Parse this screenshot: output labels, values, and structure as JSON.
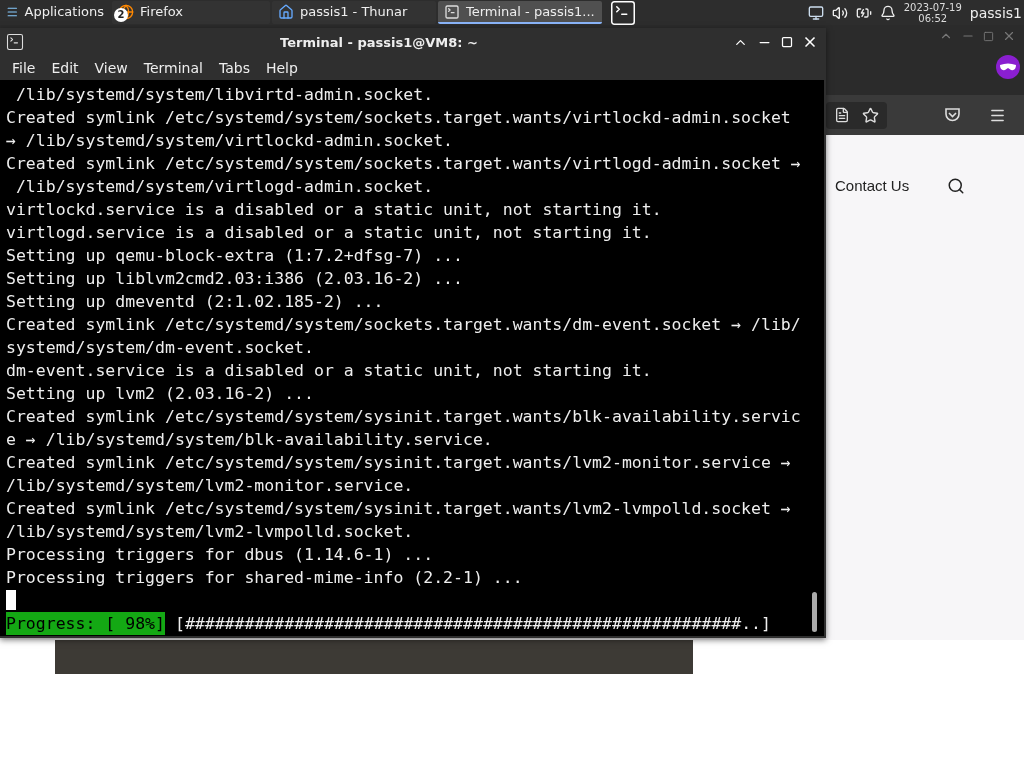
{
  "taskbar": {
    "apps_menu": {
      "label": "Applications"
    },
    "tasks": [
      {
        "kind": "browser",
        "label": "Firefox",
        "badge": "2",
        "selected": false
      },
      {
        "kind": "files",
        "label": "passis1 - Thunar",
        "selected": false
      },
      {
        "kind": "terminal",
        "label": "Terminal - passis1...",
        "selected": true
      }
    ],
    "clock": {
      "date": "2023-07-19",
      "time": "06:52"
    },
    "user": "passis1"
  },
  "browser": {
    "nav_link": "Contact Us"
  },
  "terminal": {
    "title": "Terminal - passis1@VM8: ~",
    "menu": [
      "File",
      "Edit",
      "View",
      "Terminal",
      "Tabs",
      "Help"
    ],
    "lines": [
      " /lib/systemd/system/libvirtd-admin.socket.",
      "Created symlink /etc/systemd/system/sockets.target.wants/virtlockd-admin.socket",
      "→ /lib/systemd/system/virtlockd-admin.socket.",
      "Created symlink /etc/systemd/system/sockets.target.wants/virtlogd-admin.socket →",
      " /lib/systemd/system/virtlogd-admin.socket.",
      "virtlockd.service is a disabled or a static unit, not starting it.",
      "virtlogd.service is a disabled or a static unit, not starting it.",
      "Setting up qemu-block-extra (1:7.2+dfsg-7) ...",
      "Setting up liblvm2cmd2.03:i386 (2.03.16-2) ...",
      "Setting up dmeventd (2:1.02.185-2) ...",
      "Created symlink /etc/systemd/system/sockets.target.wants/dm-event.socket → /lib/",
      "systemd/system/dm-event.socket.",
      "dm-event.service is a disabled or a static unit, not starting it.",
      "Setting up lvm2 (2.03.16-2) ...",
      "Created symlink /etc/systemd/system/sysinit.target.wants/blk-availability.servic",
      "e → /lib/systemd/system/blk-availability.service.",
      "Created symlink /etc/systemd/system/sysinit.target.wants/lvm2-monitor.service →",
      "/lib/systemd/system/lvm2-monitor.service.",
      "Created symlink /etc/systemd/system/sysinit.target.wants/lvm2-lvmpolld.socket →",
      "/lib/systemd/system/lvm2-lvmpolld.socket.",
      "Processing triggers for dbus (1.14.6-1) ...",
      "Processing triggers for shared-mime-info (2.2-1) ..."
    ],
    "progress": {
      "label": "Progress: [ 98%]",
      "bar": "[########################################################..]"
    }
  }
}
